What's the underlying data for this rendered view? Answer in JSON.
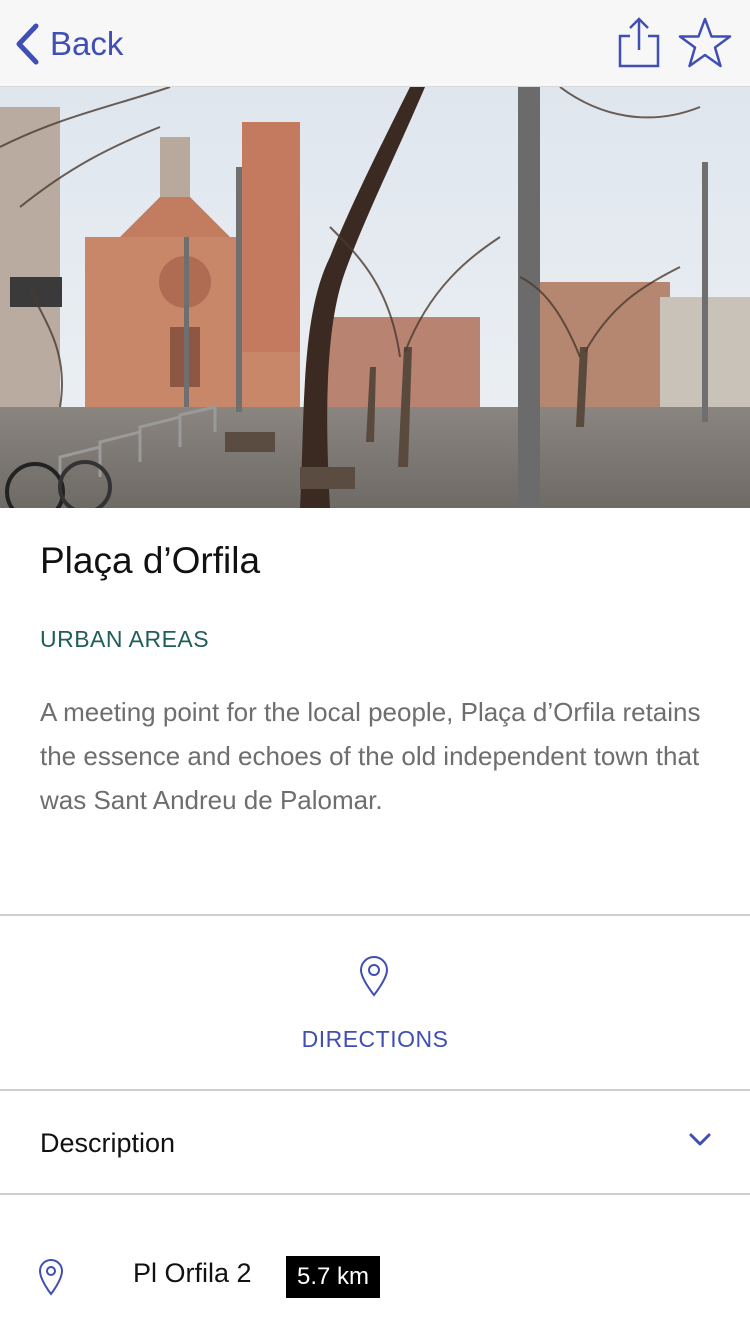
{
  "navbar": {
    "back_label": "Back",
    "share_icon": "share-icon",
    "favorite_icon": "star-outline-icon"
  },
  "place": {
    "title": "Plaça d’Orfila",
    "category": "URBAN AREAS",
    "summary": "A meeting point for the local people, Plaça d’Orfila retains the essence and echoes of the old independent town that was Sant Andreu de Palomar."
  },
  "actions": {
    "directions_label": "DIRECTIONS",
    "directions_icon": "map-pin-icon"
  },
  "description_section": {
    "label": "Description",
    "expand_icon": "chevron-down-icon"
  },
  "address": {
    "icon": "map-pin-icon",
    "text": "Pl Orfila 2",
    "distance": "5.7 km"
  },
  "colors": {
    "accent": "#3f4fb3",
    "category": "#1f5e5a",
    "body_text": "#6e6e6e",
    "navbar_bg": "#f7f7f7"
  }
}
